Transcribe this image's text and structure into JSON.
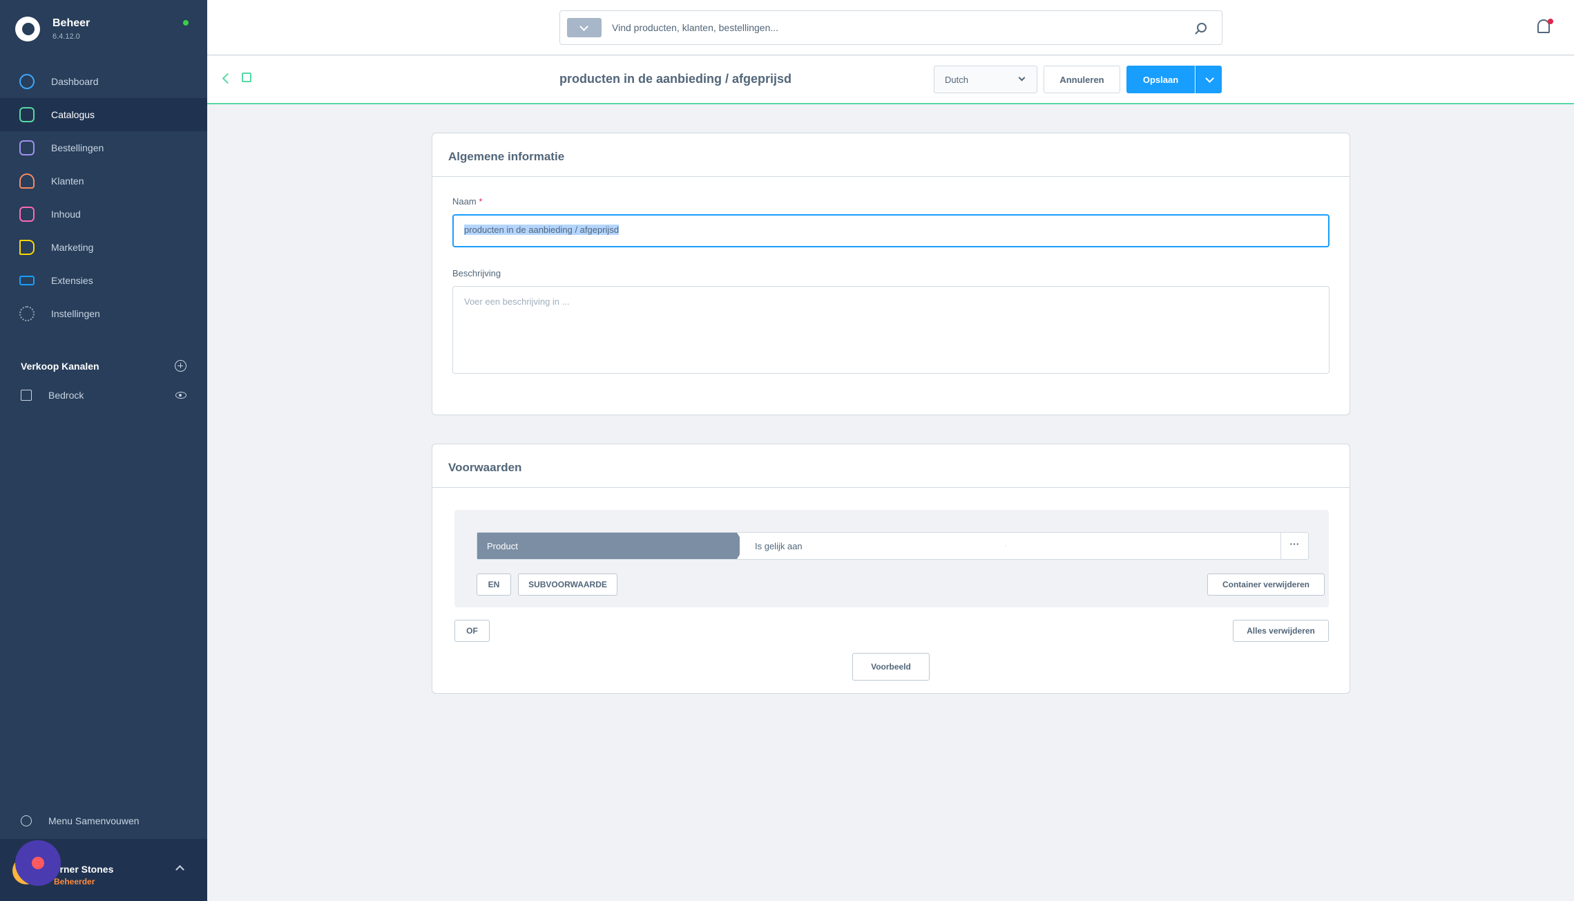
{
  "sidebar": {
    "brand_title": "Beheer",
    "brand_version": "6.4.12.0",
    "items": [
      {
        "label": "Dashboard",
        "icon": "dashboard-icon"
      },
      {
        "label": "Catalogus",
        "icon": "catalog-icon"
      },
      {
        "label": "Bestellingen",
        "icon": "orders-icon"
      },
      {
        "label": "Klanten",
        "icon": "customers-icon"
      },
      {
        "label": "Inhoud",
        "icon": "content-icon"
      },
      {
        "label": "Marketing",
        "icon": "marketing-icon"
      },
      {
        "label": "Extensies",
        "icon": "extensions-icon"
      },
      {
        "label": "Instellingen",
        "icon": "settings-icon"
      }
    ],
    "channels_title": "Verkoop Kanalen",
    "channel_name": "Bedrock",
    "collapse_label": "Menu Samenvouwen",
    "user_name": "orner Stones",
    "user_role": "Beheerder"
  },
  "topbar": {
    "search_placeholder": "Vind producten, klanten, bestellingen..."
  },
  "smartbar": {
    "title": "producten in de aanbieding / afgeprijsd",
    "language": "Dutch",
    "cancel_label": "Annuleren",
    "save_label": "Opslaan"
  },
  "general": {
    "title": "Algemene informatie",
    "name_label": "Naam",
    "required_mark": "*",
    "name_value": "producten in de aanbieding / afgeprijsd",
    "description_label": "Beschrijving",
    "description_placeholder": "Voer een beschrijving in ..."
  },
  "conditions": {
    "title": "Voorwaarden",
    "field": "Product",
    "operator": "Is gelijk aan",
    "more": "···",
    "and_label": "EN",
    "sub_label": "SUBVOORWAARDE",
    "remove_container_label": "Container verwijderen",
    "or_label": "OF",
    "remove_all_label": "Alles verwijderen",
    "preview_label": "Voorbeeld"
  },
  "colors": {
    "sidebar_bg": "#283e5a",
    "accent": "#189eff",
    "catalog_accent": "#57d9a3"
  }
}
